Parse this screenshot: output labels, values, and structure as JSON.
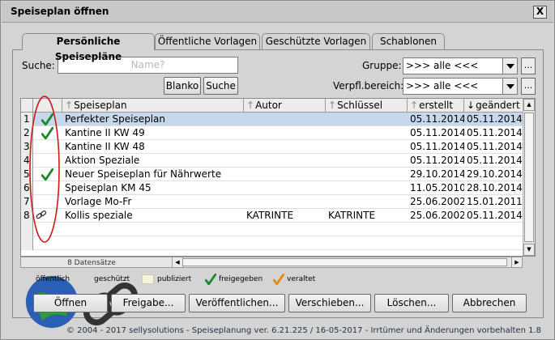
{
  "window": {
    "title": "Speiseplan öffnen",
    "close_label": "X"
  },
  "tabs": [
    {
      "label": "Persönliche Speisepläne",
      "active": true
    },
    {
      "label": "Öffentliche Vorlagen",
      "active": false
    },
    {
      "label": "Geschützte Vorlagen",
      "active": false
    },
    {
      "label": "Schablonen",
      "active": false
    }
  ],
  "search": {
    "label": "Suche:",
    "placeholder": "Name?",
    "blanko_label": "Blanko",
    "suche_label": "Suche"
  },
  "filters": {
    "gruppe_label": "Gruppe:",
    "gruppe_value": ">>> alle <<<",
    "verpfl_label": "Verpfl.bereich:",
    "verpfl_value": ">>> alle <<<",
    "more_label": "..."
  },
  "table": {
    "columns": [
      "Speiseplan",
      "Autor",
      "Schlüssel",
      "erstellt",
      "geändert"
    ],
    "rows": [
      {
        "num": "1",
        "status": "check",
        "name": "Perfekter Speiseplan",
        "author": "",
        "key": "",
        "created": "05.11.2014",
        "changed": "05.11.2014",
        "selected": true
      },
      {
        "num": "2",
        "status": "check",
        "name": "Kantine II KW 49",
        "author": "",
        "key": "",
        "created": "05.11.2014",
        "changed": "05.11.2014",
        "selected": false
      },
      {
        "num": "3",
        "status": "",
        "name": "Kantine II KW 48",
        "author": "",
        "key": "",
        "created": "05.11.2014",
        "changed": "05.11.2014",
        "selected": false
      },
      {
        "num": "4",
        "status": "",
        "name": "Aktion Speziale",
        "author": "",
        "key": "",
        "created": "05.11.2014",
        "changed": "05.11.2014",
        "selected": false
      },
      {
        "num": "5",
        "status": "check",
        "name": "Neuer Speiseplan für Nährwerte",
        "author": "",
        "key": "",
        "created": "29.10.2014",
        "changed": "29.10.2014",
        "selected": false
      },
      {
        "num": "6",
        "status": "",
        "name": "Speiseplan KM 45",
        "author": "",
        "key": "",
        "created": "11.05.2010",
        "changed": "28.10.2014",
        "selected": false
      },
      {
        "num": "7",
        "status": "",
        "name": "Vorlage Mo-Fr",
        "author": "",
        "key": "",
        "created": "25.06.2002",
        "changed": "15.01.2011",
        "selected": false
      },
      {
        "num": "8",
        "status": "chain",
        "name": "Kollis speziale",
        "author": "KATRINTE",
        "key": "KATRINTE",
        "created": "25.06.2002",
        "changed": "05.11.2014",
        "selected": false
      }
    ],
    "count_label": "8 Datensätze"
  },
  "legend": [
    {
      "icon": "globe-icon",
      "label": "öffentlich"
    },
    {
      "icon": "chain-icon",
      "label": "geschützt"
    },
    {
      "icon": "swatch-icon",
      "label": "publiziert"
    },
    {
      "icon": "green-check-icon",
      "label": "freigegeben"
    },
    {
      "icon": "orange-check-icon",
      "label": "veraltet"
    }
  ],
  "buttons": [
    "Öffnen",
    "Freigabe...",
    "Veröffentlichen...",
    "Verschieben...",
    "Löschen...",
    "Abbrechen"
  ],
  "footer": "© 2004 - 2017 sellysolutions - Speiseplanung ver. 6.21.225 / 16-05-2017 - Irrtümer und Änderungen vorbehalten  1.8",
  "colors": {
    "selected_row": "#c8d8ec",
    "check_green": "#1a8a2a",
    "check_orange": "#e08a10",
    "annotation_red": "#d01818"
  }
}
